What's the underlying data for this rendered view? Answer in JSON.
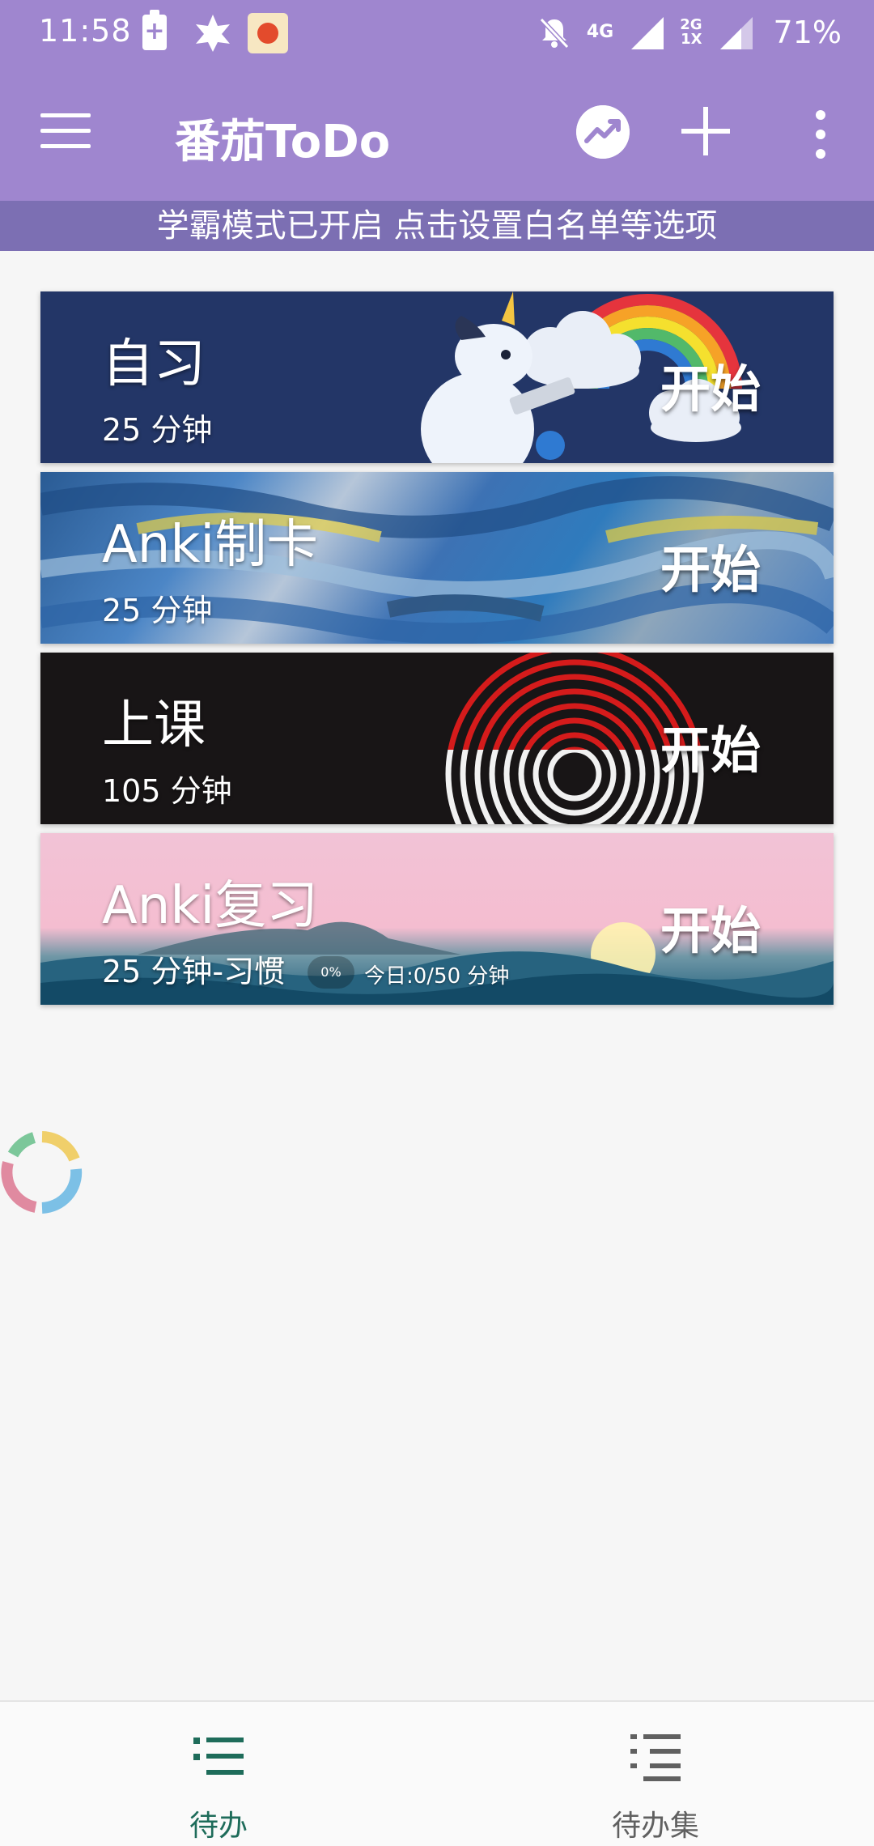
{
  "status_bar": {
    "time": "11:58",
    "network_top": "4G",
    "network_secondary_top": "2G",
    "network_secondary_bottom": "1X",
    "battery": "71%",
    "icons": [
      "battery-charging-icon",
      "puzzle-icon",
      "tomato-app-icon",
      "bell-muted-icon",
      "signal-icon"
    ]
  },
  "app_bar": {
    "title": "番茄ToDo",
    "actions": [
      "stats-icon",
      "add-icon",
      "more-icon"
    ]
  },
  "banner": {
    "text": "学霸模式已开启 点击设置白名单等选项"
  },
  "tasks": [
    {
      "name": "自习",
      "duration": "25 分钟",
      "action": "开始",
      "theme": "unicorn-rainbow"
    },
    {
      "name": "Anki制卡",
      "duration": "25 分钟",
      "action": "开始",
      "theme": "blue-paint"
    },
    {
      "name": "上课",
      "duration": "105 分钟",
      "action": "开始",
      "theme": "fingerprint"
    },
    {
      "name": "Anki复习",
      "duration": "25 分钟-习惯",
      "action": "开始",
      "theme": "sunset-sea",
      "habit_progress": "0%",
      "habit_progress_value": 0,
      "today": "今日:0/50 分钟"
    }
  ],
  "bottom_nav": {
    "items": [
      {
        "label": "待办",
        "icon": "list-icon",
        "active": true
      },
      {
        "label": "待办集",
        "icon": "list-set-icon",
        "active": false
      }
    ]
  },
  "colors": {
    "primary": "#9f86cf",
    "banner": "#7c6fb3",
    "nav_active": "#1e6c5a",
    "nav_inactive": "#606060"
  }
}
